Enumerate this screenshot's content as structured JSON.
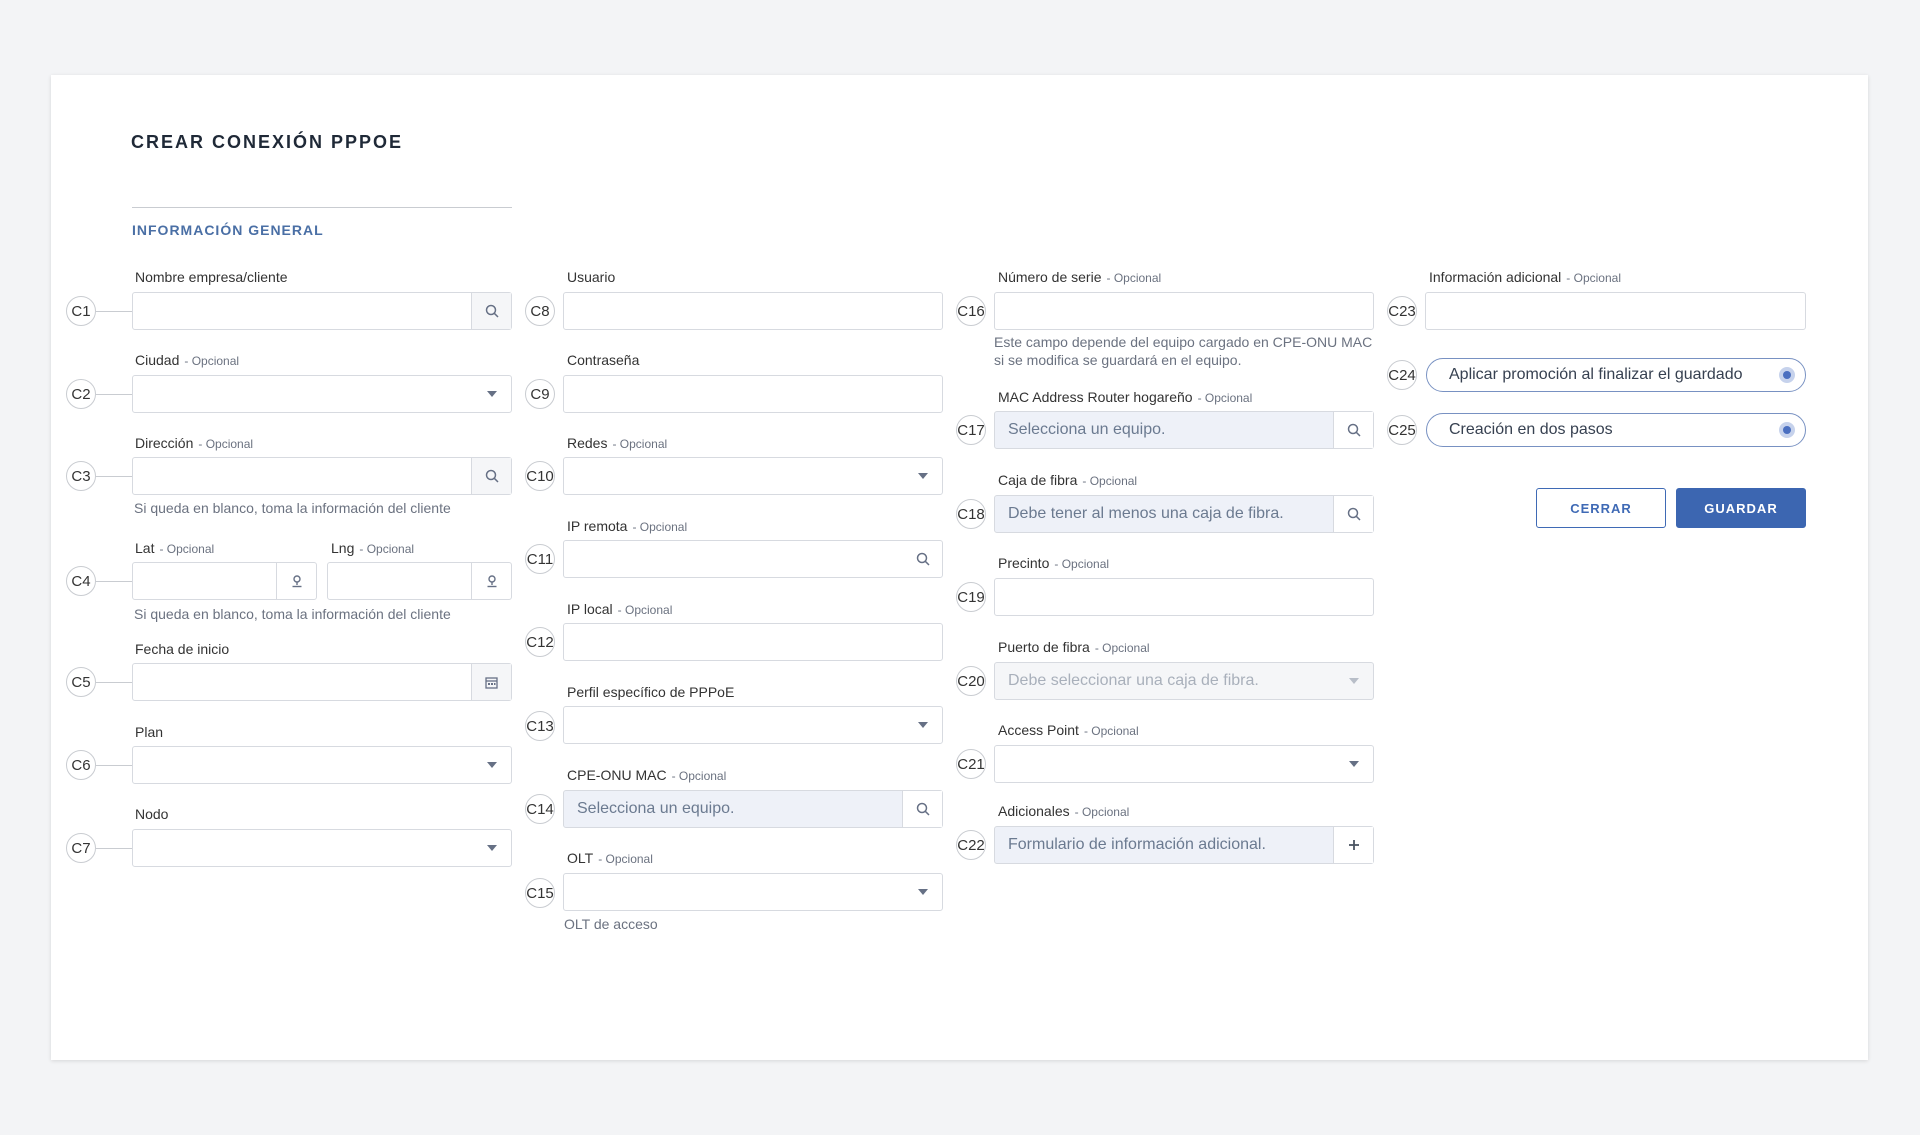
{
  "page": {
    "title": "CREAR CONEXIÓN PPPOE",
    "section": "INFORMACIÓN GENERAL"
  },
  "optional_suffix": "- Opcional",
  "badges": [
    "C1",
    "C2",
    "C3",
    "C4",
    "C5",
    "C6",
    "C7",
    "C8",
    "C9",
    "C10",
    "C11",
    "C12",
    "C13",
    "C14",
    "C15",
    "C16",
    "C17",
    "C18",
    "C19",
    "C20",
    "C21",
    "C22",
    "C23",
    "C24",
    "C25"
  ],
  "col1": {
    "nombre": {
      "label": "Nombre empresa/cliente",
      "value": ""
    },
    "ciudad": {
      "label": "Ciudad",
      "value": ""
    },
    "direccion": {
      "label": "Dirección",
      "value": "",
      "help": "Si queda en blanco, toma la información del cliente"
    },
    "lat": {
      "label": "Lat",
      "value": ""
    },
    "lng": {
      "label": "Lng",
      "value": "",
      "help": "Si queda en blanco, toma la información del cliente"
    },
    "fecha": {
      "label": "Fecha de inicio",
      "value": ""
    },
    "plan": {
      "label": "Plan",
      "value": ""
    },
    "nodo": {
      "label": "Nodo",
      "value": ""
    }
  },
  "col2": {
    "usuario": {
      "label": "Usuario",
      "value": ""
    },
    "contrasena": {
      "label": "Contraseña",
      "value": ""
    },
    "redes": {
      "label": "Redes",
      "value": ""
    },
    "ip_remota": {
      "label": "IP remota",
      "value": ""
    },
    "ip_local": {
      "label": "IP local",
      "value": ""
    },
    "perfil": {
      "label": "Perfil específico de PPPoE",
      "value": ""
    },
    "cpe": {
      "label": "CPE-ONU MAC",
      "placeholder": "Selecciona un equipo."
    },
    "olt": {
      "label": "OLT",
      "value": "",
      "help": "OLT de acceso"
    }
  },
  "col3": {
    "serie": {
      "label": "Número de serie",
      "value": "",
      "help": "Este campo depende del equipo cargado en CPE-ONU MAC si se modifica se guardará en el equipo."
    },
    "mac_router": {
      "label": "MAC Address Router hogareño",
      "placeholder": "Selecciona un equipo."
    },
    "caja": {
      "label": "Caja de fibra",
      "placeholder": "Debe tener al menos una caja de fibra."
    },
    "precinto": {
      "label": "Precinto",
      "value": ""
    },
    "puerto": {
      "label": "Puerto de fibra",
      "placeholder": "Debe seleccionar una caja de fibra."
    },
    "access_point": {
      "label": "Access Point",
      "value": ""
    },
    "adicionales": {
      "label": "Adicionales",
      "placeholder": "Formulario de información adicional."
    }
  },
  "col4": {
    "info_adicional": {
      "label": "Información adicional",
      "value": ""
    },
    "promo": {
      "label": "Aplicar promoción al finalizar el guardado"
    },
    "dos_pasos": {
      "label": "Creación en dos pasos"
    }
  },
  "buttons": {
    "close": "CERRAR",
    "save": "GUARDAR"
  },
  "colors": {
    "accent": "#3c66b1",
    "section": "#4a6fa5"
  },
  "icons": {
    "search": "search-icon",
    "select": "chevron-down-icon",
    "location": "map-pin-icon",
    "calendar": "calendar-icon",
    "add": "plus-icon"
  }
}
